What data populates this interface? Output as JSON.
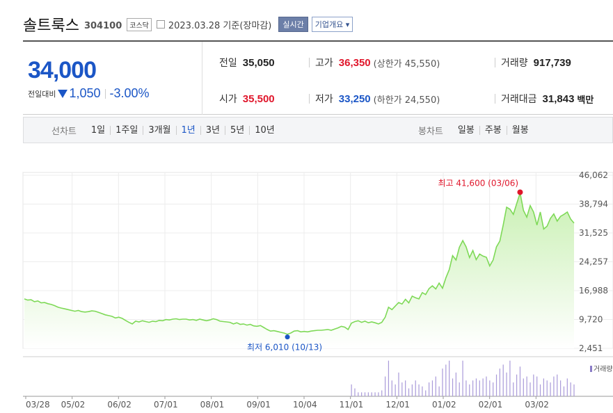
{
  "header": {
    "name": "솔트룩스",
    "code": "304100",
    "market": "코스닥",
    "date": "2023.03.28 기준(장마감)",
    "realtime_label": "실시간",
    "company_label": "기업개요 ▾"
  },
  "quote": {
    "price": "34,000",
    "change_label": "전일대비",
    "change": "1,050",
    "change_pct": "-3.00%",
    "prev_label": "전일",
    "prev": "35,050",
    "high_label": "고가",
    "high": "36,350",
    "upper_limit": "(상한가 45,550)",
    "volume_label": "거래량",
    "volume": "917,739",
    "open_label": "시가",
    "open": "35,500",
    "low_label": "저가",
    "low": "33,250",
    "lower_limit": "(하한가 24,550)",
    "amount_label": "거래대금",
    "amount": "31,843",
    "amount_unit": "백만"
  },
  "tabs": {
    "line_label": "선차트",
    "line_items": [
      "1일",
      "1주일",
      "3개월",
      "1년",
      "3년",
      "5년",
      "10년"
    ],
    "line_active": "1년",
    "candle_label": "봉차트",
    "candle_items": [
      "일봉",
      "주봉",
      "월봉"
    ]
  },
  "chart_data": {
    "type": "area",
    "x_ticks": [
      "03/28",
      "05/02",
      "06/02",
      "07/01",
      "08/01",
      "09/01",
      "10/04",
      "11/01",
      "12/01",
      "01/02",
      "02/01",
      "03/02"
    ],
    "y_ticks": [
      "46,062",
      "38,794",
      "31,525",
      "24,257",
      "16,988",
      "9,720",
      "2,451"
    ],
    "ylim": [
      2451,
      46062
    ],
    "max_annotation": "최고 41,600 (03/06)",
    "min_annotation": "최저 6,010 (10/13)",
    "volume_legend": "거래량",
    "colors": {
      "line": "#7ed957",
      "fill_top": "#c9f0b3",
      "max": "#e0162b",
      "min": "#1b56c6"
    },
    "price_series": [
      14900,
      14600,
      14700,
      14200,
      14400,
      13900,
      14000,
      13700,
      13500,
      13200,
      12800,
      12600,
      12400,
      12200,
      12000,
      11800,
      12000,
      11700,
      11600,
      11700,
      11900,
      11800,
      11500,
      11200,
      10900,
      10700,
      10500,
      10100,
      10300,
      10000,
      9500,
      9000,
      8600,
      9300,
      9100,
      9400,
      9200,
      9000,
      9300,
      9200,
      9500,
      9400,
      9700,
      9600,
      9800,
      9900,
      9700,
      9800,
      9800,
      9600,
      9700,
      9500,
      9800,
      9600,
      9400,
      9600,
      9900,
      9700,
      9300,
      9200,
      9100,
      9000,
      8600,
      8900,
      8500,
      8600,
      8300,
      8500,
      8100,
      8000,
      8200,
      7700,
      7200,
      6800,
      6900,
      6700,
      6500,
      6300,
      6010,
      6300,
      6800,
      6900,
      6600,
      6700,
      6600,
      6800,
      6900,
      7000,
      7000,
      7100,
      7200,
      7000,
      7300,
      7600,
      8000,
      7800,
      7200,
      8800,
      9200,
      9400,
      9000,
      9300,
      8900,
      9100,
      8900,
      8600,
      9000,
      10300,
      12800,
      12200,
      13100,
      14000,
      13600,
      14800,
      13900,
      15600,
      15200,
      14900,
      16500,
      16000,
      17500,
      18200,
      17400,
      18900,
      17600,
      20200,
      22300,
      25800,
      24700,
      27900,
      29600,
      28000,
      25300,
      27100,
      24800,
      26200,
      25700,
      25400,
      23200,
      24700,
      28000,
      29500,
      33500,
      38000,
      37500,
      36200,
      38900,
      41600,
      37200,
      35500,
      38400,
      36800,
      33500,
      36800,
      32500,
      33200,
      35200,
      36300,
      34500,
      35700,
      36200,
      36800,
      35000,
      34000
    ],
    "volume_series": [
      0,
      0,
      0,
      0,
      0,
      0,
      0,
      0,
      0,
      0,
      0,
      0,
      0,
      0,
      0,
      0,
      0,
      0,
      0,
      0,
      0,
      0,
      0,
      0,
      0,
      0,
      0,
      0,
      0,
      0,
      0,
      0,
      0,
      0,
      0,
      0,
      0,
      0,
      0,
      0,
      0,
      0,
      0,
      0,
      0,
      0,
      0,
      0,
      0,
      0,
      0,
      0,
      0,
      0,
      0,
      0,
      0,
      0,
      0,
      0,
      0,
      0,
      0,
      0,
      0,
      0,
      0,
      0,
      0,
      0,
      0,
      0,
      0,
      0,
      0,
      0,
      0,
      0,
      0,
      0,
      0,
      0,
      0,
      0,
      0,
      0,
      0,
      0,
      0,
      0,
      0,
      0,
      0,
      0,
      0,
      0,
      0,
      0.3,
      0.2,
      0.1,
      0.1,
      0.1,
      0.1,
      0.1,
      0.1,
      0.1,
      0.15,
      0.5,
      0.9,
      0.4,
      0.3,
      0.6,
      0.35,
      0.4,
      0.2,
      0.3,
      0.4,
      0.3,
      0.25,
      0.15,
      0.35,
      0.4,
      0.5,
      0.25,
      0.7,
      0.8,
      0.9,
      0.45,
      0.6,
      0.35,
      0.9,
      0.4,
      0.3,
      0.4,
      0.45,
      0.4,
      0.45,
      0.5,
      0.4,
      0.35,
      0.55,
      0.7,
      0.8,
      0.6,
      0.9,
      0.35,
      0.55,
      0.75,
      0.45,
      0.5,
      0.35,
      0.55,
      0.5,
      0.3,
      0.45,
      0.4,
      0.35,
      0.5,
      0.55,
      0.4,
      0.25,
      0.45,
      0.35,
      0.3
    ]
  }
}
